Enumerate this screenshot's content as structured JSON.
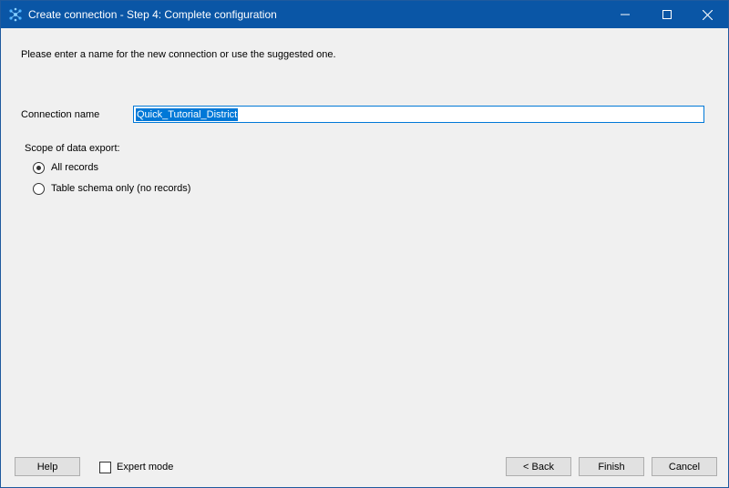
{
  "window": {
    "title": "Create connection - Step 4: Complete configuration",
    "titlebar_color": "#0a56a6",
    "app_icon": "network-nodes-icon",
    "controls": [
      "minimize-icon",
      "maximize-icon",
      "close-icon"
    ]
  },
  "content": {
    "prompt": "Please enter a name for the new connection or use the suggested one.",
    "connection_name_label": "Connection name",
    "connection_name_value": "Quick_Tutorial_District",
    "scope_label": "Scope of data export:",
    "scope_options": [
      {
        "label": "All records",
        "checked": true
      },
      {
        "label": "Table schema only (no records)",
        "checked": false
      }
    ]
  },
  "footer": {
    "help_label": "Help",
    "expert_mode_label": "Expert mode",
    "expert_mode_checked": false,
    "back_label": "< Back",
    "finish_label": "Finish",
    "cancel_label": "Cancel"
  },
  "colors": {
    "selection": "#0078d7",
    "background": "#f0f0f0"
  }
}
